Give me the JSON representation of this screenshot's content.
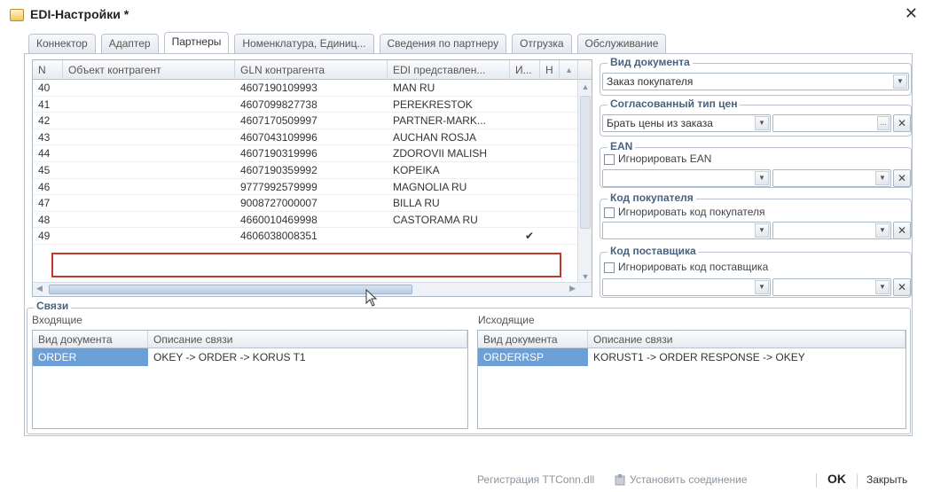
{
  "window": {
    "title": "EDI-Настройки *",
    "close_glyph": "✕"
  },
  "tabs": [
    {
      "label": "Коннектор",
      "active": false
    },
    {
      "label": "Адаптер",
      "active": false
    },
    {
      "label": "Партнеры",
      "active": true
    },
    {
      "label": "Номенклатура, Единиц...",
      "active": false
    },
    {
      "label": "Сведения по партнеру",
      "active": false
    },
    {
      "label": "Отгрузка",
      "active": false
    },
    {
      "label": "Обслуживание",
      "active": false
    }
  ],
  "partners_grid": {
    "columns": [
      "N",
      "Объект контрагент",
      "GLN контрагента",
      "EDI представлен...",
      "И...",
      "Н"
    ],
    "rows": [
      {
        "n": "40",
        "object": "",
        "gln": "4607190109993",
        "edi": "MAN RU",
        "i": ""
      },
      {
        "n": "41",
        "object": "",
        "gln": "4607099827738",
        "edi": "PEREKRESTOK",
        "i": ""
      },
      {
        "n": "42",
        "object": "",
        "gln": "4607170509997",
        "edi": "PARTNER-MARK...",
        "i": ""
      },
      {
        "n": "43",
        "object": "",
        "gln": "4607043109996",
        "edi": "AUCHAN ROSJA",
        "i": ""
      },
      {
        "n": "44",
        "object": "",
        "gln": "4607190319996",
        "edi": "ZDOROVII MALISH",
        "i": ""
      },
      {
        "n": "45",
        "object": "",
        "gln": "4607190359992",
        "edi": "KOPEIKA",
        "i": ""
      },
      {
        "n": "46",
        "object": "",
        "gln": "9777992579999",
        "edi": "MAGNOLIA RU",
        "i": ""
      },
      {
        "n": "47",
        "object": "",
        "gln": "9008727000007",
        "edi": "BILLA RU",
        "i": ""
      },
      {
        "n": "48",
        "object": "",
        "gln": "4660010469998",
        "edi": "CASTORAMA RU",
        "i": ""
      },
      {
        "n": "49",
        "object": "",
        "gln": "4606038008351",
        "edi": "",
        "i": "✔"
      }
    ]
  },
  "settings": {
    "doc_type": {
      "title": "Вид документа",
      "value": "Заказ покупателя"
    },
    "price_type": {
      "title": "Согласованный тип цен",
      "value": "Брать цены из заказа",
      "dots": "...",
      "clear": "✕"
    },
    "ean": {
      "title": "EAN",
      "checkbox_label": "Игнорировать EAN",
      "clear": "✕"
    },
    "buyer_code": {
      "title": "Код покупателя",
      "checkbox_label": "Игнорировать код покупателя",
      "clear": "✕"
    },
    "supplier_code": {
      "title": "Код поставщика",
      "checkbox_label": "Игнорировать код поставщика",
      "clear": "✕"
    }
  },
  "links": {
    "title": "Связи",
    "incoming": {
      "title": "Входящие",
      "columns": [
        "Вид документа",
        "Описание связи"
      ],
      "rows": [
        {
          "doc": "ORDER",
          "desc": "OKEY -> ORDER -> KORUS T1"
        }
      ]
    },
    "outgoing": {
      "title": "Исходящие",
      "columns": [
        "Вид документа",
        "Описание связи"
      ],
      "rows": [
        {
          "doc": "ORDERRSP",
          "desc": "KORUST1 -> ORDER RESPONSE -> OKEY"
        }
      ]
    }
  },
  "footer": {
    "register": "Регистрация TTConn.dll",
    "connect": "Установить соединение",
    "ok": "OK",
    "close": "Закрыть"
  },
  "colors": {
    "accent_title": "#47627f",
    "selection": "#6a9fd8",
    "highlight_box": "#c0392b"
  }
}
